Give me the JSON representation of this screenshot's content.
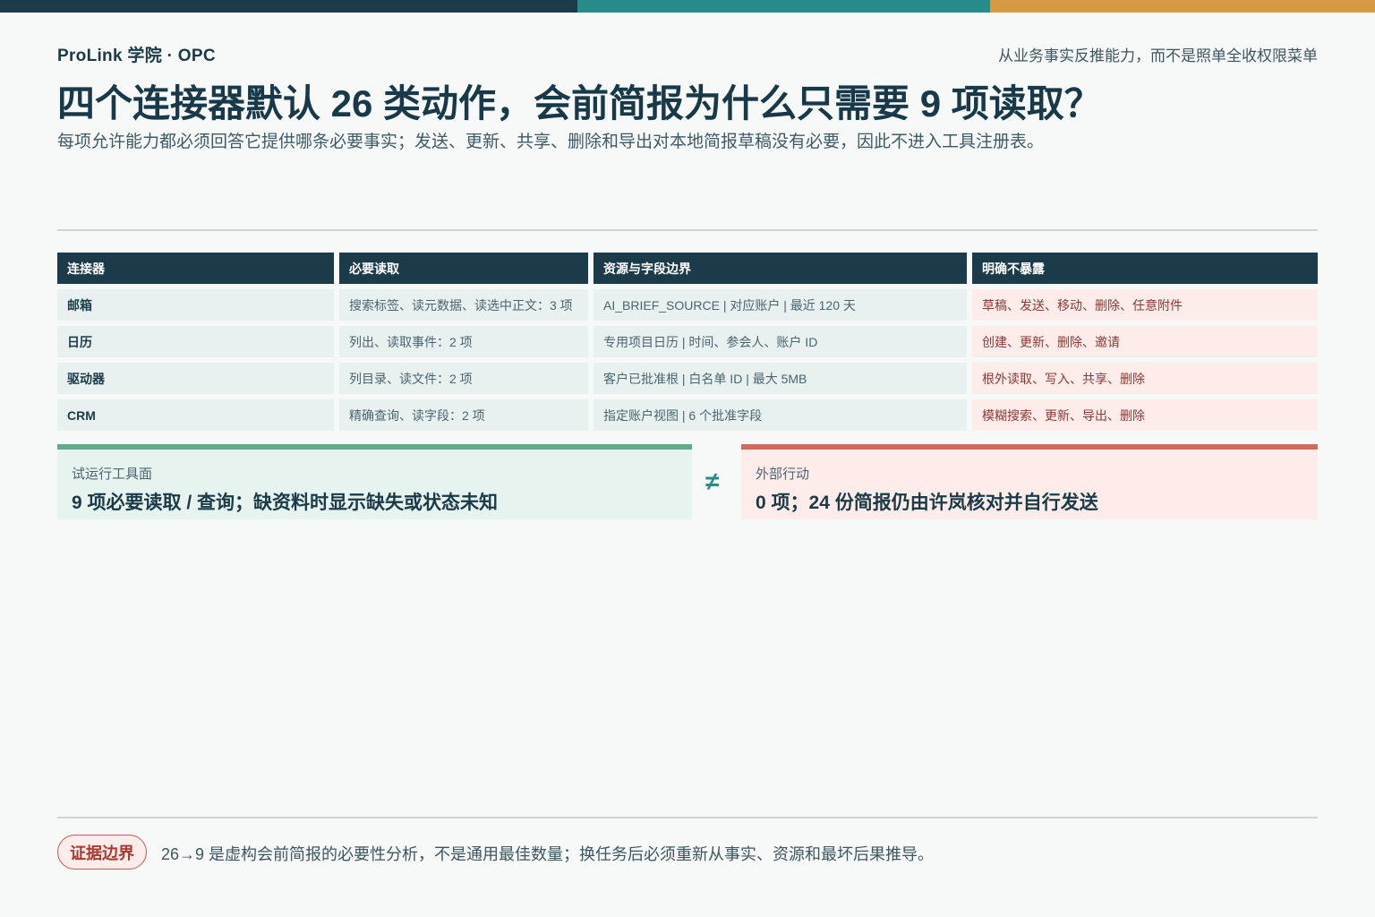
{
  "colors": {
    "topbar": [
      "#1b3b4a",
      "#2a8c8a",
      "#d69a45"
    ],
    "panel_left_accent": "#6aa88a",
    "panel_right_accent": "#d06a60"
  },
  "header": {
    "brand": "ProLink 学院 · OPC",
    "tagline": "从业务事实反推能力，而不是照单全收权限菜单",
    "title": "四个连接器默认 26 类动作，会前简报为什么只需要 9 项读取？",
    "subtitle": "每项允许能力都必须回答它提供哪条必要事实；发送、更新、共享、删除和导出对本地简报草稿没有必要，因此不进入工具注册表。"
  },
  "table": {
    "headers": [
      "连接器",
      "必要读取",
      "资源与字段边界",
      "明确不暴露"
    ],
    "rows": [
      [
        "邮箱",
        "搜索标签、读元数据、读选中正文：3 项",
        "AI_BRIEF_SOURCE | 对应账户 | 最近 120 天",
        "草稿、发送、移动、删除、任意附件"
      ],
      [
        "日历",
        "列出、读取事件：2 项",
        "专用项目日历 | 时间、参会人、账户 ID",
        "创建、更新、删除、邀请"
      ],
      [
        "驱动器",
        "列目录、读文件：2 项",
        "客户已批准根 | 白名单 ID | 最大 5MB",
        "根外读取、写入、共享、删除"
      ],
      [
        "CRM",
        "精确查询、读字段：2 项",
        "指定账户视图 | 6 个批准字段",
        "模糊搜索、更新、导出、删除"
      ]
    ]
  },
  "panels": {
    "left": {
      "label": "试运行工具面",
      "value": "9 项必要读取 / 查询；缺资料时显示缺失或状态未知"
    },
    "neq": "≠",
    "right": {
      "label": "外部行动",
      "value": "0 项；24 份简报仍由许岚核对并自行发送"
    }
  },
  "footer": {
    "badge": "证据边界",
    "note": "26→9 是虚构会前简报的必要性分析，不是通用最佳数量；换任务后必须重新从事实、资源和最坏后果推导。"
  }
}
